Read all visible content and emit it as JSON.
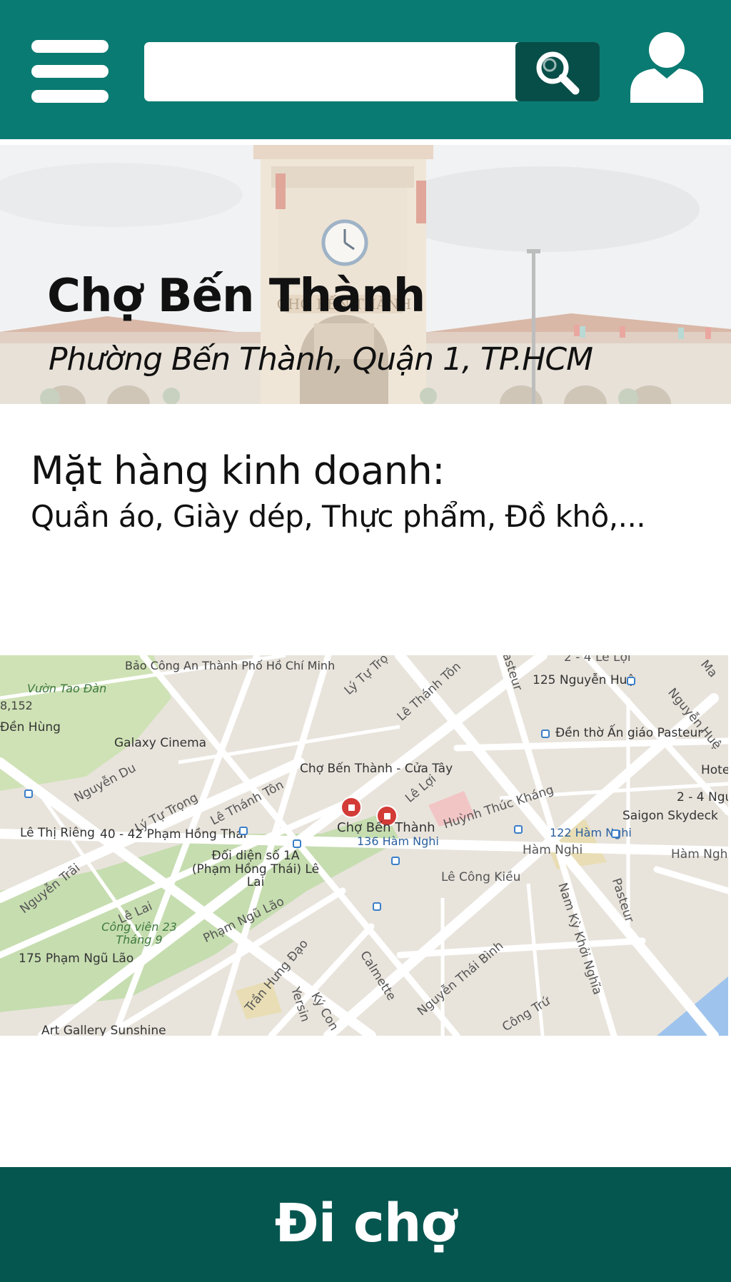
{
  "header": {
    "menu_icon": "hamburger-menu-icon",
    "search_placeholder": "",
    "search_value": "",
    "search_icon": "magnifier-icon",
    "user_icon": "user-profile-icon"
  },
  "hero": {
    "title": "Chợ Bến Thành",
    "address": "Phường Bến Thành, Quận 1, TP.HCM",
    "photo_sign": "CHỢ BẾN THÀNH"
  },
  "goods": {
    "label": "Mặt hàng kinh doanh:",
    "items": "Quần áo, Giày dép, Thực phẩm, Đồ khô,..."
  },
  "map": {
    "markers": [
      "Chợ Bến Thành - Cửa Tây",
      "Chợ Bến Thành"
    ],
    "labels": [
      "Bảo Công An Thành Phố Hồ Chí Minh",
      "Vườn Tao Đàn",
      "8,152",
      "Đền Hùng",
      "Galaxy Cinema",
      "Nguyễn Du",
      "Lý Tự Trọng",
      "Lê Thánh Tôn",
      "Lê Thị Riêng",
      "40 - 42 Phạm Hồng Thái",
      "Đối diện số 1A (Phạm Hồng Thái) Lê Lai",
      "Nguyễn Trãi",
      "Lê Lai",
      "Công viên 23 Tháng 9",
      "175 Phạm Ngũ Lão",
      "Art Gallery Sunshine",
      "Phạm Ngũ Lão",
      "Trần Hưng Đạo",
      "Yersin",
      "Ký Con",
      "Calmette",
      "Nguyễn Thái Bình",
      "Công Trứ",
      "Nam Kỳ Khởi Nghĩa",
      "Pasteur",
      "Lê Công Kiều",
      "136 Hàm Nghi",
      "122 Hàm Nghi",
      "Hàm Nghi",
      "Hàm Ngh",
      "Huỳnh Thúc Kháng",
      "Saigon Skydeck",
      "2 - 4 Ngu",
      "Hote",
      "Lê Lợi",
      "Đền thờ Ấn giáo Pasteur",
      "125 Nguyễn Huệ",
      "Nguyễn Huệ",
      "Lê Thánh Tôn",
      "Lý Tự Trọ",
      "asteur",
      "2 - 4 Lê Lợi",
      "Ma"
    ]
  },
  "footer": {
    "button_label": "Đi chợ"
  },
  "colors": {
    "header_bg": "#0a7b72",
    "search_button_bg": "#074e48",
    "bottom_button_bg": "#065650",
    "marker": "#d33b37"
  }
}
